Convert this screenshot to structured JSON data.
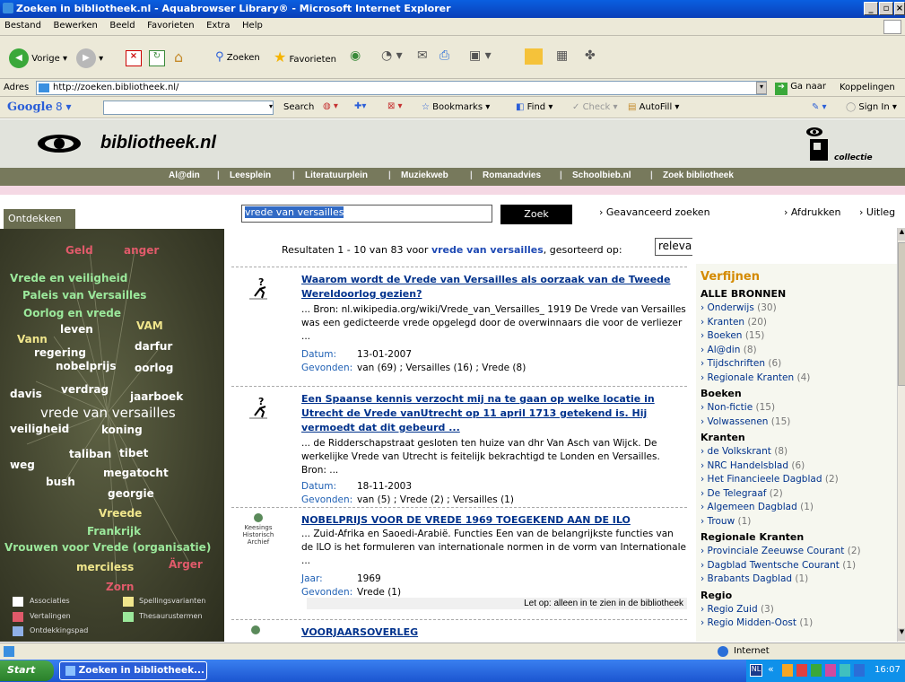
{
  "window": {
    "title": "Zoeken in bibliotheek.nl - Aquabrowser Library® - Microsoft Internet Explorer"
  },
  "menu": [
    "Bestand",
    "Bewerken",
    "Beeld",
    "Favorieten",
    "Extra",
    "Help"
  ],
  "toolbar": {
    "back": "Vorige",
    "search": "Zoeken",
    "favorites": "Favorieten"
  },
  "address": {
    "label": "Adres",
    "url": "http://zoeken.bibliotheek.nl/",
    "go": "Ga naar",
    "links": "Koppelingen"
  },
  "googlebar": {
    "search": "Search",
    "bookmarks": "Bookmarks",
    "find": "Find",
    "check": "Check",
    "autofill": "AutoFill",
    "signin": "Sign In"
  },
  "site": {
    "brand": "bibliotheek.nl",
    "collectie": "collectie",
    "nav": [
      "Al@din",
      "Leesplein",
      "Literatuurplein",
      "Muziekweb",
      "Romanadvies",
      "Schoolbieb.nl",
      "Zoek bibliotheek"
    ]
  },
  "sidebar": {
    "tab": "Ontdekken",
    "legend": [
      "Associaties",
      "Spellingsvarianten",
      "Vertalingen",
      "Thesaurustermen",
      "Ontdekkingspad"
    ],
    "colors": {
      "assoc": "#ffffff",
      "spell": "#f0e68c",
      "trans": "#e05a6a",
      "thes": "#9be89b",
      "path": "#8fb0e8"
    }
  },
  "search": {
    "query": "vrede van versailles",
    "button": "Zoek",
    "advanced": "Geavanceerd zoeken",
    "print": "Afdrukken",
    "explain": "Uitleg"
  },
  "summary": {
    "pre": "Resultaten 1 - 10 van 83 voor",
    "query": "vrede van versailles",
    "post": ", gesorteerd op:",
    "sort": "relevantie"
  },
  "results": [
    {
      "title": "Waarom wordt de Vrede van Versailles als oorzaak van de Tweede Wereldoorlog gezien?",
      "snippet": "... Bron: nl.wikipedia.org/wiki/Vrede_van_Versailles_ 1919 De Vrede van Versailles was een gedicteerde vrede opgelegd door de overwinnaars die voor de verliezer ...",
      "k1": "Datum:",
      "v1": "13-01-2007",
      "k2": "Gevonden:",
      "v2": "van (69) ; Versailles (16) ; Vrede (8)"
    },
    {
      "title": "Een Spaanse kennis verzocht mij na te gaan op welke locatie in Utrecht de Vrede vanUtrecht op 11 april 1713 getekend is. Hij vermoedt dat dit gebeurd ...",
      "snippet": "... de Ridderschapstraat gesloten ten huize van dhr Van Asch van Wijck. De werkelijke Vrede van Utrecht is feitelijk bekrachtigd te Londen en Versailles. Bron: ...",
      "k1": "Datum:",
      "v1": "18-11-2003",
      "k2": "Gevonden:",
      "v2": "van (5) ; Vrede (2) ; Versailles (1)"
    },
    {
      "title": "NOBELPRIJS VOOR DE VREDE 1969 TOEGEKEND AAN DE ILO",
      "snippet": "... Zuid-Afrika en Saoedi-Arabië. Functies Een van de belangrijkste functies van de ILO is het formuleren van internationale normen in de vorm van Internationale ...",
      "k1": "Jaar:",
      "v1": "1969",
      "k2": "Gevonden:",
      "v2": "Vrede (1)",
      "note": "Let op: alleen in te zien in de bibliotheek",
      "source": "Keesings Historisch Archief"
    },
    {
      "title": "VOORJAARSOVERLEG"
    }
  ],
  "refine": {
    "title": "Verfijnen",
    "groups": [
      {
        "h": "ALLE BRONNEN",
        "items": [
          [
            "Onderwijs",
            "(30)"
          ],
          [
            "Kranten",
            "(20)"
          ],
          [
            "Boeken",
            "(15)"
          ],
          [
            "Al@din",
            "(8)"
          ],
          [
            "Tijdschriften",
            "(6)"
          ],
          [
            "Regionale Kranten",
            "(4)"
          ]
        ]
      },
      {
        "h": "Boeken",
        "items": [
          [
            "Non-fictie",
            "(15)"
          ],
          [
            "Volwassenen",
            "(15)"
          ]
        ]
      },
      {
        "h": "Kranten",
        "items": [
          [
            "de Volkskrant",
            "(8)"
          ],
          [
            "NRC Handelsblad",
            "(6)"
          ],
          [
            "Het Financieele Dagblad",
            "(2)"
          ],
          [
            "De Telegraaf",
            "(2)"
          ],
          [
            "Algemeen Dagblad",
            "(1)"
          ],
          [
            "Trouw",
            "(1)"
          ]
        ]
      },
      {
        "h": "Regionale Kranten",
        "items": [
          [
            "Provinciale Zeeuwse Courant",
            "(2)"
          ],
          [
            "Dagblad Twentsche Courant",
            "(1)"
          ],
          [
            "Brabants Dagblad",
            "(1)"
          ]
        ]
      },
      {
        "h": "Regio",
        "items": [
          [
            "Regio Zuid",
            "(3)"
          ],
          [
            "Regio Midden-Oost",
            "(1)"
          ]
        ]
      }
    ]
  },
  "cloud": {
    "main": "vrede van versailles",
    "words": [
      "Geld",
      "anger",
      "Vrede en veiligheid",
      "Paleis van Versailles",
      "Oorlog en vrede",
      "leven",
      "VAM",
      "Vann",
      "regering",
      "darfur",
      "nobelprijs",
      "oorlog",
      "davis",
      "verdrag",
      "jaarboek",
      "veiligheid",
      "koning",
      "taliban",
      "tibet",
      "weg",
      "megatocht",
      "bush",
      "georgie",
      "Vreede",
      "Frankrijk",
      "Vrouwen voor Vrede (organisatie)",
      "merciless",
      "Ärger",
      "Zorn"
    ]
  },
  "status": {
    "zone": "Internet"
  },
  "taskbar": {
    "start": "Start",
    "task": "Zoeken in bibliotheek...",
    "clock": "16:07"
  }
}
